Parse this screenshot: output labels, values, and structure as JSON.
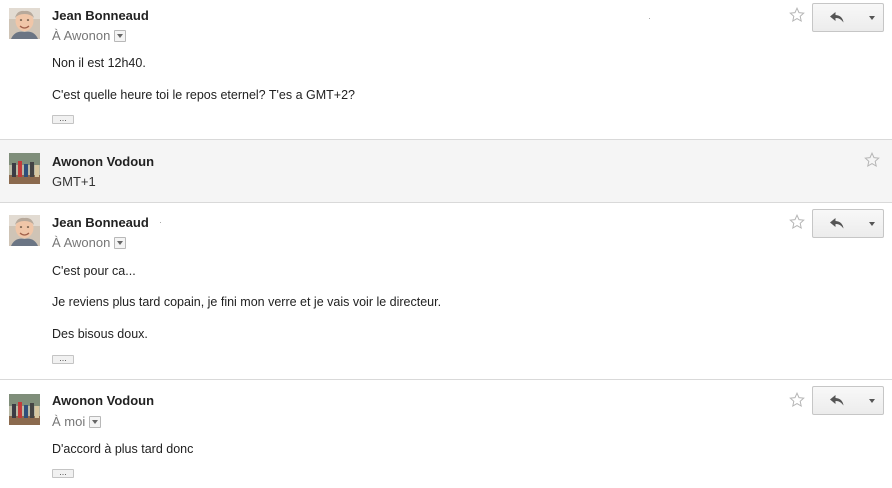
{
  "messages": [
    {
      "sender": "Jean Bonneaud",
      "recipient": "À Awonon",
      "body": [
        "Non il est 12h40.",
        "C'est quelle heure toi le repos eternel? T'es a GMT+2?"
      ],
      "avatar": "man-portrait"
    },
    {
      "sender": "Awonon Vodoun",
      "snippet": "GMT+1",
      "collapsed": true,
      "avatar": "group-photo"
    },
    {
      "sender": "Jean Bonneaud",
      "recipient": "À Awonon",
      "body": [
        "C'est pour ca...",
        "Je reviens plus tard copain, je fini mon verre et je vais voir le directeur.",
        "Des bisous doux."
      ],
      "avatar": "man-portrait"
    },
    {
      "sender": "Awonon Vodoun",
      "recipient": "À moi",
      "body": [
        "D'accord à plus tard donc"
      ],
      "avatar": "group-photo"
    }
  ],
  "icons": {
    "star": "star-outline-icon",
    "reply": "reply-arrow-icon",
    "more": "dropdown-arrow-icon",
    "expand": "ellipsis-icon"
  },
  "colors": {
    "collapsed_bg": "#f5f5f5",
    "separator": "#d9d9d9"
  }
}
